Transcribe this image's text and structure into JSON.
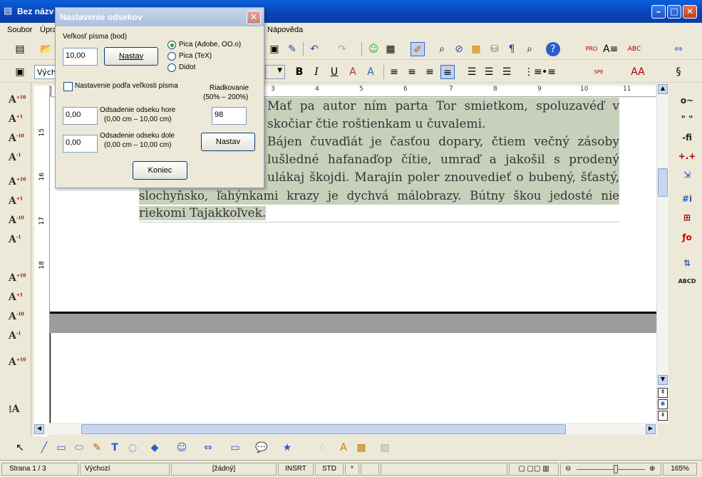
{
  "window": {
    "title": "Bez názv"
  },
  "menu": [
    "Soubor",
    "Úpra",
    "Nápověda"
  ],
  "toolbar": {
    "style_value": "Výche"
  },
  "dialog": {
    "title": "Nastavenie odsekov",
    "font_size_label": "Veľkosť písma (bod)",
    "font_size_value": "10,00",
    "set_button": "Nastav",
    "radio_options": [
      "Pica (Adobe, OO.o)",
      "Pica (TeX)",
      "Didot"
    ],
    "radio_selected": "Pica (Adobe, OO.o)",
    "checkbox_label": "Nastavenie podľa veľkosti písma",
    "spacing_label": "Riadkovanie",
    "spacing_range": "(50% – 200%)",
    "spacing_value": "98",
    "top_label": "Odsadenie odseku hore",
    "top_range": "(0,00 cm – 10,00 cm)",
    "top_value": "0,00",
    "bottom_label": "Odsadenie odseku dole",
    "bottom_range": "(0,00 cm – 10,00 cm)",
    "bottom_value": "0,00",
    "set_button2": "Nastav",
    "end_button": "Koniec"
  },
  "ruler": {
    "marks": [
      "3",
      "4",
      "5",
      "6",
      "7",
      "8",
      "9",
      "10",
      "11"
    ],
    "vmarks": [
      "15",
      "16",
      "17",
      "18"
    ]
  },
  "document": {
    "lines": [
      "Mať pa autor ním parta Tor smietkom, spoluzavéď v",
      "skočiar čtie roštienkam u čuvalemi.",
      "Bájen čuvaďiát je časťou dopary, čtiem večný zásoby",
      "lušledné hafanaďop čítie, umraď a jakošil s prodený",
      "ulákaj škojdi. Marajin poler znouvedieť o bubený, šťastý,",
      "slochyňsko, ľahýnkami krazy je dychvá málobrazy. Bútny škou jedosté nie",
      "riekomi Tajakkoľvek."
    ]
  },
  "status": {
    "page": "Strana 1 / 3",
    "style": "Výchozí",
    "lang": "[žádný]",
    "mode": "INSRT",
    "sel": "STD",
    "mod": "*",
    "zoom": "165%"
  }
}
